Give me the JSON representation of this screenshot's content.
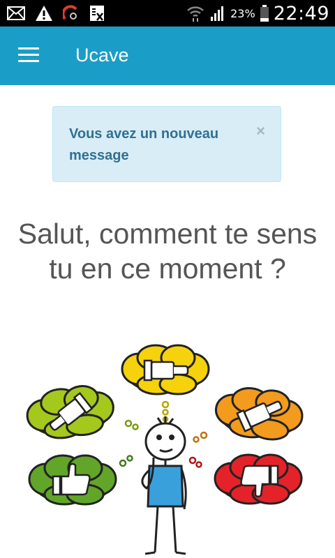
{
  "status_bar": {
    "battery_percent": "23%",
    "time": "22:49",
    "icons": [
      "mail-icon",
      "warning-icon",
      "speedometer-icon",
      "message-icon",
      "wifi-icon",
      "signal-icon",
      "battery-icon"
    ]
  },
  "app_bar": {
    "title": "Ucave",
    "menu_icon": "hamburger-menu-icon"
  },
  "alert": {
    "message": "Vous avez un nouveau message",
    "close_label": "×"
  },
  "question": "Salut, comment te sens tu en ce moment ?",
  "illustration": {
    "moods": [
      "thumb-sideways-yellow",
      "thumb-sideways-lime",
      "thumb-up-green",
      "thumb-down-orange",
      "thumb-down-red"
    ],
    "colors": {
      "yellow": "#f5d20c",
      "lime": "#a5c81d",
      "green": "#62a629",
      "orange": "#f29b1d",
      "red": "#e5222a",
      "shirt": "#3aa0dc"
    }
  },
  "theme": {
    "appbar": "#1a9ec7",
    "alert_bg": "#d9edf7",
    "alert_text": "#31708f"
  }
}
